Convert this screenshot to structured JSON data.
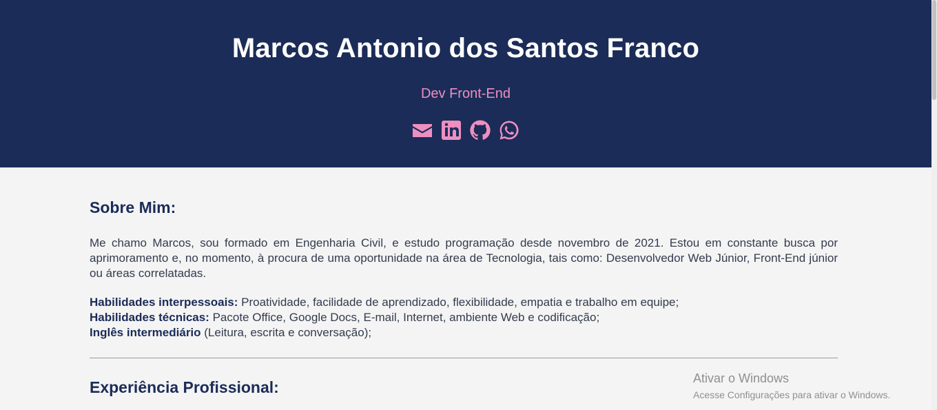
{
  "header": {
    "name": "Marcos Antonio dos Santos Franco",
    "role": "Dev Front-End",
    "socials": [
      {
        "icon": "envelope-icon"
      },
      {
        "icon": "linkedin-icon"
      },
      {
        "icon": "github-icon"
      },
      {
        "icon": "whatsapp-icon"
      }
    ]
  },
  "about": {
    "title": "Sobre Mim:",
    "paragraph": "Me chamo Marcos, sou formado em Engenharia Civil, e estudo programação desde novembro de 2021. Estou em constante busca por aprimoramento e, no momento, à procura de uma oportunidade na área de Tecnologia, tais como: Desenvolvedor Web Júnior, Front-End júnior ou áreas correlatadas.",
    "skills": [
      {
        "label": "Habilidades interpessoais:",
        "text": " Proatividade, facilidade de aprendizado, flexibilidade, empatia e trabalho em equipe;"
      },
      {
        "label": "Habilidades técnicas:",
        "text": " Pacote Office, Google Docs, E-mail, Internet, ambiente Web e codificação;"
      },
      {
        "label": "Inglês intermediário",
        "text": " (Leitura, escrita e conversação);"
      }
    ]
  },
  "experience": {
    "title": "Experiência Profissional:"
  },
  "watermark": {
    "title": "Ativar o Windows",
    "subtitle": "Acesse Configurações para ativar o Windows."
  },
  "colors": {
    "header_bg": "#1b2c58",
    "accent": "#ee8fc0",
    "page_bg": "#f4f4f4"
  }
}
